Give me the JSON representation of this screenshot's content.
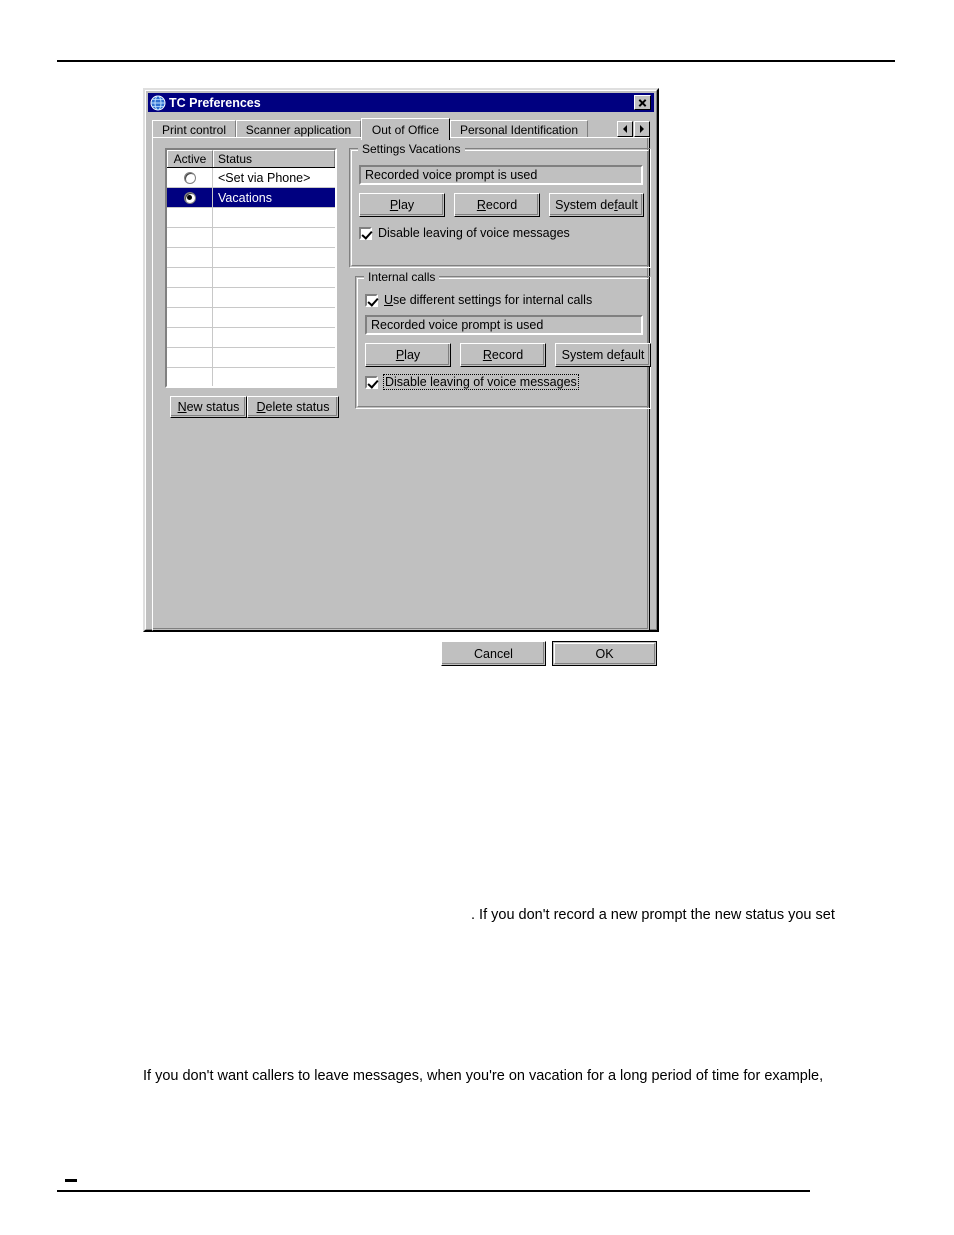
{
  "document": {
    "paragraph_fragment": ". If you don't record a new prompt the new status you set",
    "paragraph_body": "If you don't want callers to leave messages, when you're on vacation for a long period of time for example,",
    "footer_dash": "-"
  },
  "dialog": {
    "title": "TC Preferences",
    "icon": "globe-icon",
    "close_label": "x",
    "colors": {
      "titlebar": "#000080",
      "face": "#c0c0c0",
      "selection": "#000080",
      "text": "#000000"
    },
    "tabs": [
      {
        "label": "Print control",
        "selected": false
      },
      {
        "label": "Scanner application",
        "selected": false
      },
      {
        "label": "Out of Office",
        "selected": true
      },
      {
        "label": "Personal Identification",
        "selected": false
      }
    ],
    "tab_scroll": {
      "prev": "scroll-tabs-left",
      "next": "scroll-tabs-right"
    },
    "status_list": {
      "columns": [
        "Active",
        "Status"
      ],
      "rows": [
        {
          "active": false,
          "status": "<Set via Phone>",
          "selected": false
        },
        {
          "active": true,
          "status": "Vacations",
          "selected": true
        },
        {
          "active": null,
          "status": "",
          "selected": false
        },
        {
          "active": null,
          "status": "",
          "selected": false
        },
        {
          "active": null,
          "status": "",
          "selected": false
        },
        {
          "active": null,
          "status": "",
          "selected": false
        },
        {
          "active": null,
          "status": "",
          "selected": false
        },
        {
          "active": null,
          "status": "",
          "selected": false
        },
        {
          "active": null,
          "status": "",
          "selected": false
        },
        {
          "active": null,
          "status": "",
          "selected": false
        },
        {
          "active": null,
          "status": "",
          "selected": false
        }
      ]
    },
    "list_buttons": {
      "new_status": "New status",
      "new_status_mnemonic": "N",
      "delete_status": "Delete status",
      "delete_status_mnemonic": "D"
    },
    "settings_group": {
      "title": "Settings Vacations",
      "prompt_value": "Recorded voice prompt is used",
      "play": "Play",
      "play_mnemonic": "P",
      "record": "Record",
      "record_mnemonic": "R",
      "system_default": "System default",
      "system_default_mnemonic": "f",
      "disable_messages_label": "Disable leaving of voice messages",
      "disable_messages_mnemonic": "g",
      "disable_messages_checked": true
    },
    "internal_group": {
      "title": "Internal calls",
      "use_different_label": "Use different settings for internal calls",
      "use_different_mnemonic": "U",
      "use_different_checked": true,
      "prompt_value": "Recorded voice prompt is used",
      "play": "Play",
      "play_mnemonic": "P",
      "record": "Record",
      "record_mnemonic": "R",
      "system_default": "System default",
      "system_default_mnemonic": "f",
      "disable_messages_label": "Disable leaving of voice messages",
      "disable_messages_checked": true,
      "disable_messages_focused": true
    },
    "footer_buttons": {
      "cancel": "Cancel",
      "ok": "OK",
      "default": "OK"
    }
  }
}
